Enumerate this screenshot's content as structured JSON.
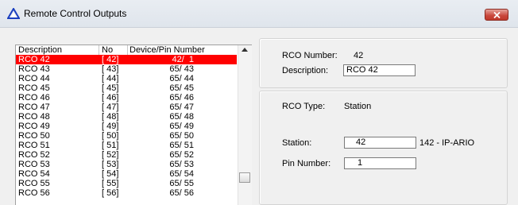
{
  "window": {
    "title": "Remote Control Outputs"
  },
  "list": {
    "columns": [
      "Description",
      "No",
      "Device/Pin Number"
    ],
    "rows": [
      {
        "desc": "RCO 42",
        "no": "[ 42]",
        "dev": "42/  1"
      },
      {
        "desc": "RCO 43",
        "no": "[ 43]",
        "dev": "65/ 43"
      },
      {
        "desc": "RCO 44",
        "no": "[ 44]",
        "dev": "65/ 44"
      },
      {
        "desc": "RCO 45",
        "no": "[ 45]",
        "dev": "65/ 45"
      },
      {
        "desc": "RCO 46",
        "no": "[ 46]",
        "dev": "65/ 46"
      },
      {
        "desc": "RCO 47",
        "no": "[ 47]",
        "dev": "65/ 47"
      },
      {
        "desc": "RCO 48",
        "no": "[ 48]",
        "dev": "65/ 48"
      },
      {
        "desc": "RCO 49",
        "no": "[ 49]",
        "dev": "65/ 49"
      },
      {
        "desc": "RCO 50",
        "no": "[ 50]",
        "dev": "65/ 50"
      },
      {
        "desc": "RCO 51",
        "no": "[ 51]",
        "dev": "65/ 51"
      },
      {
        "desc": "RCO 52",
        "no": "[ 52]",
        "dev": "65/ 52"
      },
      {
        "desc": "RCO 53",
        "no": "[ 53]",
        "dev": "65/ 53"
      },
      {
        "desc": "RCO 54",
        "no": "[ 54]",
        "dev": "65/ 54"
      },
      {
        "desc": "RCO 55",
        "no": "[ 55]",
        "dev": "65/ 55"
      },
      {
        "desc": "RCO 56",
        "no": "[ 56]",
        "dev": "65/ 56"
      }
    ],
    "selected_index": 0
  },
  "details": {
    "rco_number_label": "RCO Number:",
    "rco_number_value": "42",
    "description_label": "Description:",
    "description_value": "RCO 42",
    "rco_type_label": "RCO Type:",
    "rco_type_value": "Station",
    "station_label": "Station:",
    "station_value": "42",
    "station_name": "142 - IP-ARIO",
    "pin_number_label": "Pin Number:",
    "pin_number_value": "1"
  },
  "colors": {
    "selection": "#ff0000",
    "close_button": "#c9473b",
    "app_icon": "#1a3fbf"
  }
}
